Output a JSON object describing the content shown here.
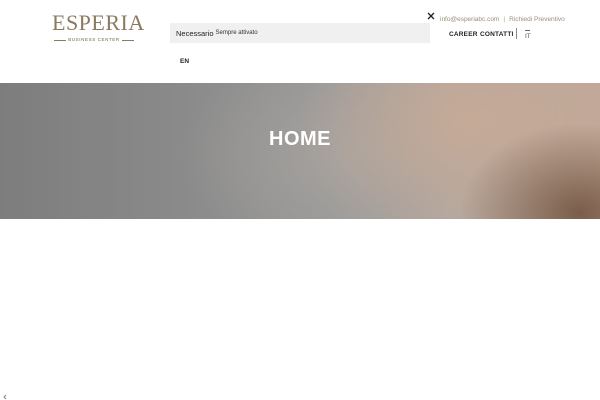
{
  "logo": {
    "word": "ESPERIA",
    "subtitle": "BUSINESS CENTER"
  },
  "cookie_bar": {
    "category": "Necessario",
    "status": "Sempre attivato"
  },
  "top_links": {
    "email": "info@esperiabc.com",
    "separator": "|",
    "quote": "Richiedi Preventivo"
  },
  "nav": {
    "career": "CAREER",
    "contatti": "CONTATTI"
  },
  "languages": {
    "current": "IT",
    "alternate": "EN"
  },
  "hero": {
    "title": "HOME"
  },
  "icons": {
    "close": "close-icon",
    "arrow": "chevron-left-icon"
  },
  "colors": {
    "brand": "#8a7a5f",
    "cookie_bg": "#f0f0f0",
    "hero_text": "#ffffff"
  }
}
